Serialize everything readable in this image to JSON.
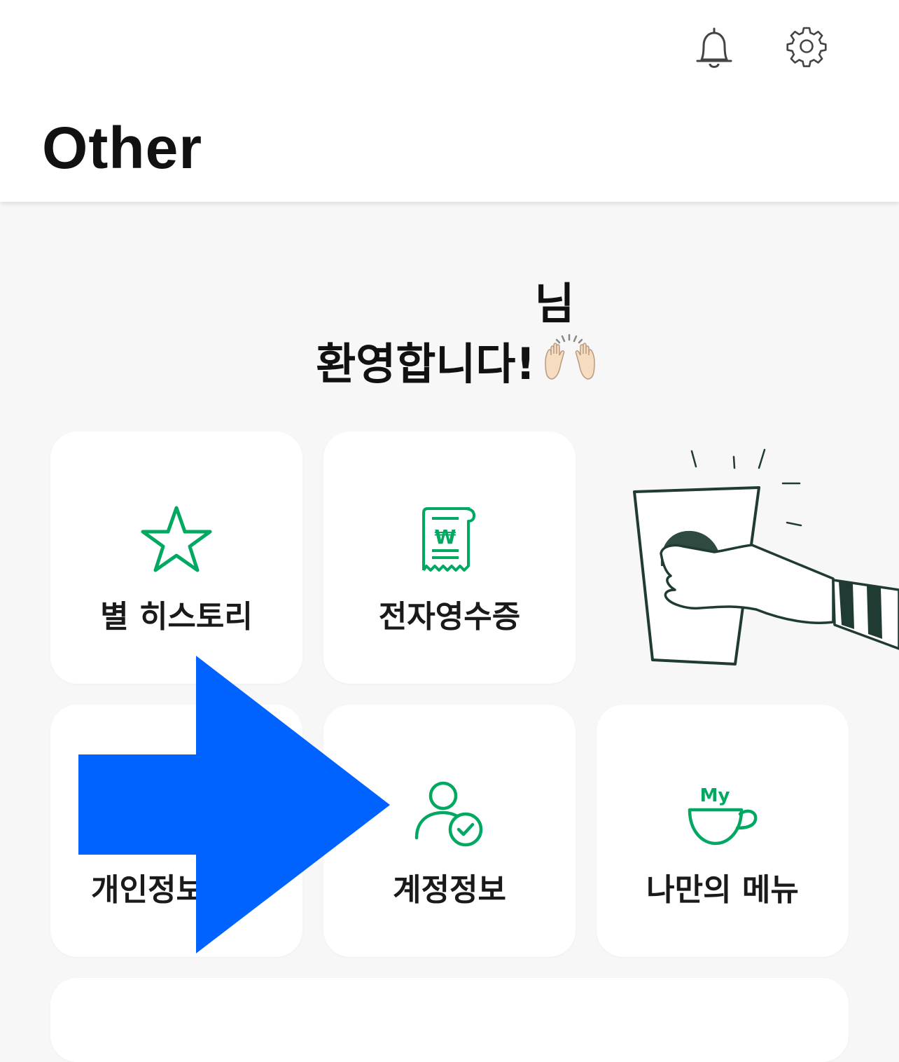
{
  "header": {
    "title": "Other",
    "icons": [
      "bell-icon",
      "gear-icon"
    ]
  },
  "greeting": {
    "name_suffix": "님",
    "welcome": "환영합니다!"
  },
  "menu": {
    "star_history": {
      "label": "별 히스토리",
      "icon": "star-icon"
    },
    "e_receipt": {
      "label": "전자영수증",
      "icon": "receipt-won-icon",
      "icon_text": "₩"
    },
    "personal_info": {
      "label": "개인정보",
      "icon": "personal-info-icon"
    },
    "account_info": {
      "label": "계정정보",
      "icon": "user-check-icon"
    },
    "my_menu": {
      "label": "나만의 메뉴",
      "icon": "my-cup-icon",
      "icon_text": "My"
    }
  },
  "colors": {
    "accent_green": "#00a862",
    "overlay_arrow": "#0062ff",
    "background": "#f7f7f7",
    "card": "#ffffff"
  }
}
